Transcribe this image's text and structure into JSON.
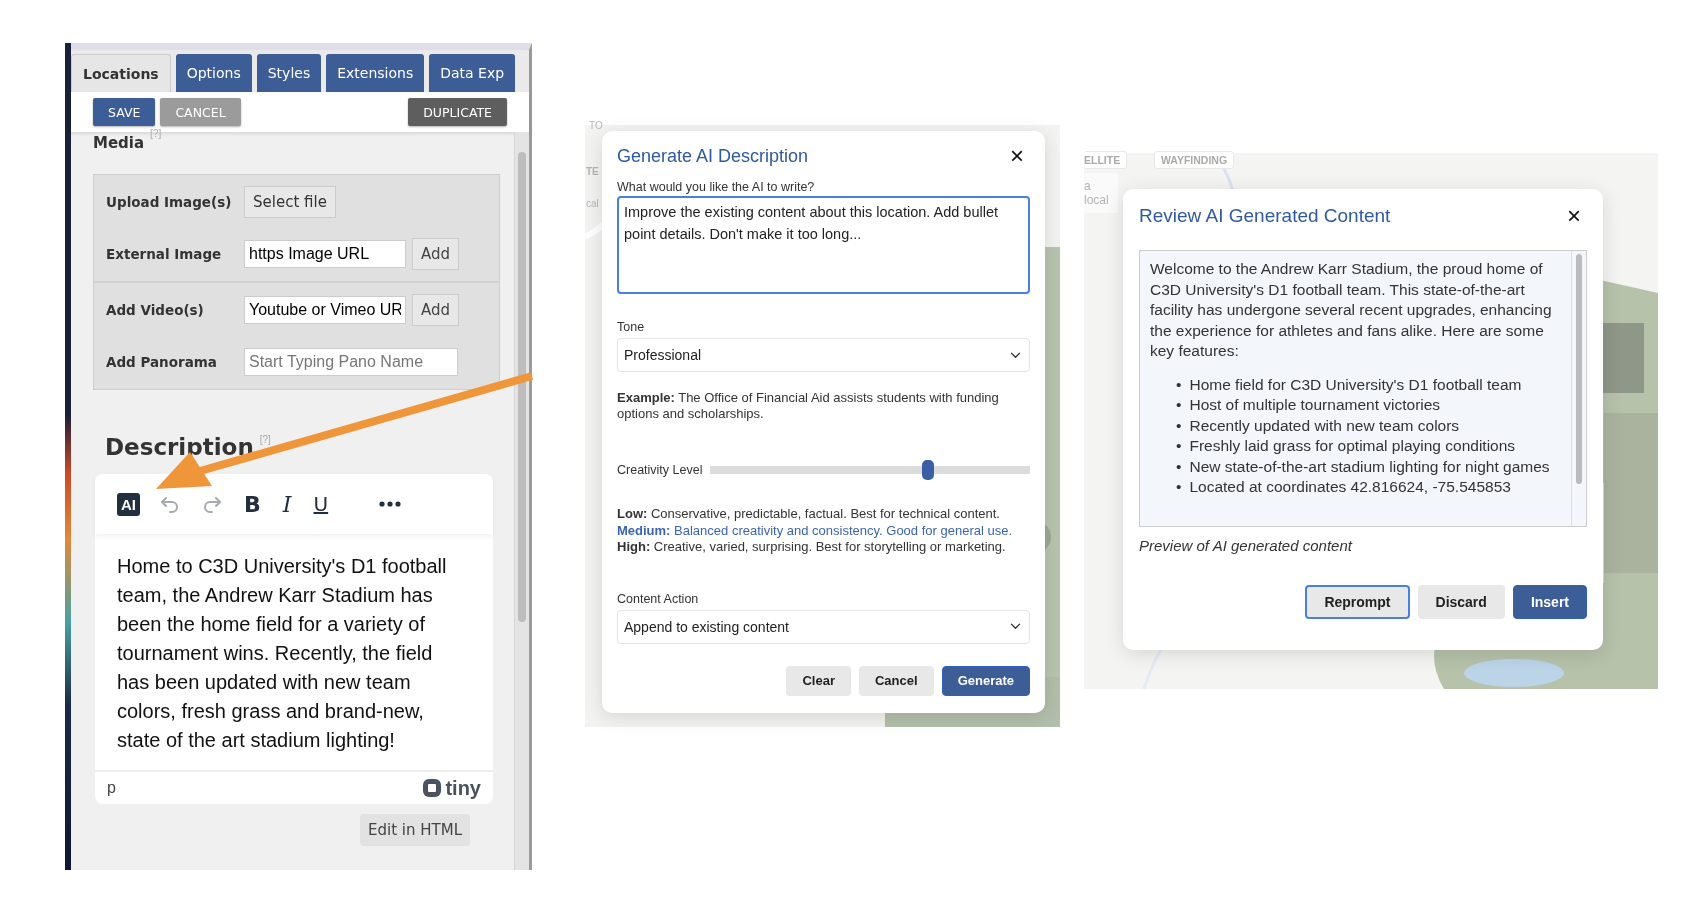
{
  "editor_panel": {
    "tabs": [
      {
        "label": "Locations",
        "selected": true
      },
      {
        "label": "Options",
        "selected": false
      },
      {
        "label": "Styles",
        "selected": false
      },
      {
        "label": "Extensions",
        "selected": false
      },
      {
        "label": "Data Exp",
        "selected": false
      }
    ],
    "actions": {
      "save": "SAVE",
      "cancel": "CANCEL",
      "duplicate": "DUPLICATE"
    },
    "media": {
      "heading": "Media",
      "help": "[?]",
      "sections": [
        {
          "rows": [
            {
              "kind": "file",
              "label": "Upload Image(s)",
              "button": "Select file"
            },
            {
              "kind": "input",
              "label": "External Image",
              "value": "https Image URL",
              "button": "Add"
            }
          ]
        },
        {
          "rows": [
            {
              "kind": "input",
              "label": "Add Video(s)",
              "value": "Youtube or Vimeo UR",
              "button": "Add"
            },
            {
              "kind": "search",
              "label": "Add Panorama",
              "placeholder": "Start Typing Pano Name"
            }
          ]
        }
      ]
    },
    "description": {
      "heading": "Description",
      "help": "[?]",
      "toolbar": [
        {
          "kind": "ai",
          "label": "AI"
        },
        {
          "kind": "undo",
          "disabled": true
        },
        {
          "kind": "redo",
          "disabled": true
        },
        {
          "kind": "bold",
          "label": "B"
        },
        {
          "kind": "italic",
          "label": "I"
        },
        {
          "kind": "underline",
          "label": "U"
        },
        {
          "kind": "more"
        }
      ],
      "text": "Home to C3D University's D1 football team, the Andrew Karr Stadium has been the home field for a variety of tournament wins. Recently, the field has been updated with new team colors, fresh grass and brand-new, state of the art stadium lighting!",
      "status_path": "p",
      "brand": "tiny",
      "html_button": "Edit in HTML"
    }
  },
  "generate_dialog": {
    "background_labels": [
      "TO",
      "TE",
      "cal"
    ],
    "title": "Generate AI Description",
    "close": "×",
    "prompt_label": "What would you like the AI to write?",
    "prompt_value": "Improve the existing content about this location. Add bullet point details. Don't make it too long...",
    "prompt_focused": true,
    "tone_label": "Tone",
    "tone_value": "Professional",
    "example": "**Example:** The Office of Financial Aid assists students with funding options and scholarships.",
    "creativity_label": "Creativity Level",
    "creativity": {
      "level": 0.68
    },
    "levels": [
      {
        "text": "**Low:** Conservative, predictable, factual. Best for technical content.",
        "selected": false
      },
      {
        "text": "**Medium:** Balanced creativity and consistency. Good for general use.",
        "selected": true
      },
      {
        "text": "**High:** Creative, varied, surprising. Best for storytelling or marketing.",
        "selected": false
      }
    ],
    "action_label": "Content Action",
    "action_value": "Append to existing content",
    "buttons": [
      {
        "kind": "secondary",
        "label": "Clear"
      },
      {
        "kind": "secondary",
        "label": "Cancel"
      },
      {
        "kind": "primary",
        "label": "Generate"
      }
    ]
  },
  "review_dialog": {
    "background_labels": [
      "ELLITE",
      "WAYFINDING",
      "a local"
    ],
    "title": "Review AI Generated Content",
    "close": "×",
    "intro": "Welcome to the Andrew Karr Stadium, the proud home of C3D University's D1 football team. This state-of-the-art facility has undergone several recent upgrades, enhancing the experience for athletes and fans alike. Here are some key features:",
    "bullets": [
      {
        "marker": "•",
        "text": "Home field for C3D University's D1 football team"
      },
      {
        "marker": "•",
        "text": "Host of multiple tournament victories"
      },
      {
        "marker": "•",
        "text": "Recently updated with new team colors"
      },
      {
        "marker": "•",
        "text": "Freshly laid grass for optimal playing conditions"
      },
      {
        "marker": "•",
        "text": "New state-of-the-art stadium lighting for night games"
      },
      {
        "marker": "•",
        "text": "Located at coordinates 42.816624, -75.545853"
      }
    ],
    "caption": "Preview of AI generated content",
    "buttons": [
      {
        "kind": "secondary",
        "label": "Reprompt",
        "focused": true
      },
      {
        "kind": "secondary",
        "label": "Discard",
        "focused": false
      },
      {
        "kind": "primary",
        "label": "Insert",
        "focused": false
      }
    ]
  }
}
